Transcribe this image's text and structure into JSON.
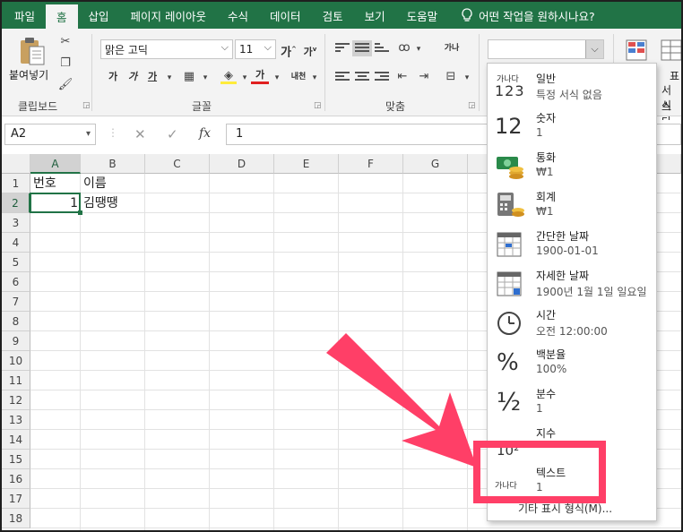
{
  "ribbon": {
    "tabs": [
      "파일",
      "홈",
      "삽입",
      "페이지 레이아웃",
      "수식",
      "데이터",
      "검토",
      "보기",
      "도움말"
    ],
    "active_tab": "홈",
    "tell_me": "어떤 작업을 원하시나요?",
    "clipboard": {
      "paste_label": "붙여넣기",
      "group_label": "클립보드"
    },
    "font": {
      "name": "맑은 고딕",
      "size": "11",
      "bold": "가",
      "italic": "가",
      "underline": "가",
      "font_color": "가",
      "phonetic": "내천",
      "group_label": "글꼴"
    },
    "alignment": {
      "group_label": "맞춤",
      "wrap": "가나"
    },
    "number_format": {
      "value": ""
    },
    "right_partial": {
      "label1": "표",
      "label2": "서식",
      "label3": "스타"
    }
  },
  "formula_bar": {
    "name_box": "A2",
    "fx": "fx",
    "value": "1"
  },
  "sheet": {
    "columns": [
      "A",
      "B",
      "C",
      "D",
      "E",
      "F",
      "G"
    ],
    "rows": [
      "1",
      "2",
      "3",
      "4",
      "5",
      "6",
      "7",
      "8",
      "9",
      "10",
      "11",
      "12",
      "13",
      "14",
      "15",
      "16",
      "17",
      "18"
    ],
    "selected_column": "A",
    "selected_row": "2",
    "cells": {
      "A1": "번호",
      "B1": "이름",
      "A2": "1",
      "B2": "김땡땡"
    }
  },
  "number_format_menu": {
    "items": [
      {
        "icon": "general-format-icon",
        "icon_text": "가나다",
        "icon_text2": "123",
        "title": "일반",
        "sub": "특정 서식 없음"
      },
      {
        "icon": "number-format-icon",
        "icon_text": "12",
        "title": "숫자",
        "sub": "1"
      },
      {
        "icon": "currency-icon",
        "title": "통화",
        "sub": "₩1"
      },
      {
        "icon": "accounting-icon",
        "title": "회계",
        "sub": " ₩1"
      },
      {
        "icon": "short-date-icon",
        "title": "간단한 날짜",
        "sub": "1900-01-01"
      },
      {
        "icon": "long-date-icon",
        "title": "자세한 날짜",
        "sub": "1900년 1월 1일 일요일"
      },
      {
        "icon": "clock-icon",
        "title": "시간",
        "sub": "오전 12:00:00"
      },
      {
        "icon": "percent-icon",
        "icon_text": "%",
        "title": "백분율",
        "sub": "100%"
      },
      {
        "icon": "fraction-icon",
        "icon_text": "½",
        "title": "분수",
        "sub": "1"
      },
      {
        "icon": "scientific-icon",
        "icon_text": "10²",
        "title": "지수",
        "sub": ""
      },
      {
        "icon": "text-format-icon",
        "icon_text": "가나다",
        "title": "텍스트",
        "sub": "1"
      }
    ],
    "more": "기타 표시 형식(M)..."
  },
  "annotation_color": "#ff3f67",
  "accent_color": "#217346"
}
